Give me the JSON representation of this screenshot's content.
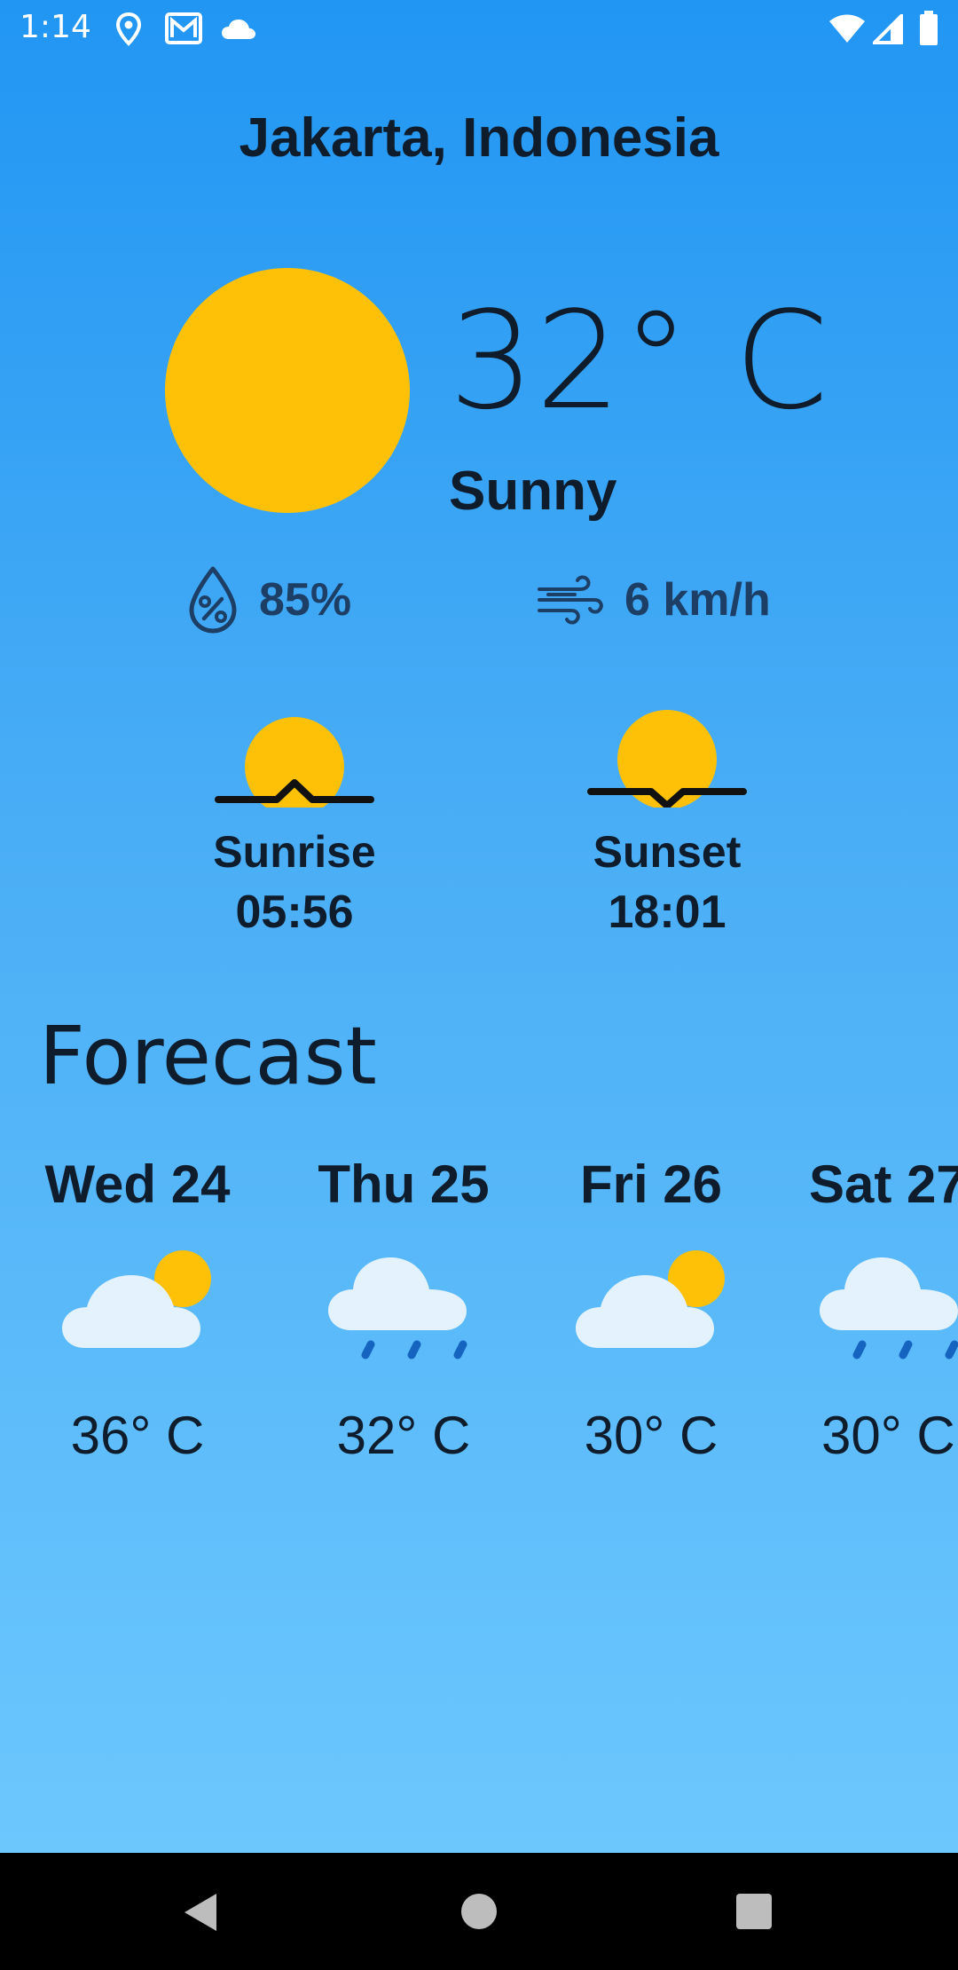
{
  "status_bar": {
    "time": "1:14",
    "icons": [
      "location-icon",
      "mail-icon",
      "cloud-icon",
      "wifi-icon",
      "signal-icon",
      "battery-icon"
    ]
  },
  "location": "Jakarta, Indonesia",
  "current": {
    "icon": "sun-icon",
    "temperature": "32° C",
    "condition": "Sunny",
    "humidity": "85%",
    "wind": "6 km/h"
  },
  "sun": {
    "sunrise_label": "Sunrise",
    "sunrise_time": "05:56",
    "sunset_label": "Sunset",
    "sunset_time": "18:01"
  },
  "forecast": {
    "title": "Forecast",
    "days": [
      {
        "day": "Wed 24",
        "icon": "partly-cloudy-icon",
        "temp": "36° C"
      },
      {
        "day": "Thu 25",
        "icon": "rain-cloud-icon",
        "temp": "32° C"
      },
      {
        "day": "Fri 26",
        "icon": "partly-cloudy-icon",
        "temp": "30° C"
      },
      {
        "day": "Sat 27",
        "icon": "rain-cloud-icon",
        "temp": "30° C"
      }
    ]
  },
  "colors": {
    "sun": "#ffc107",
    "cloud": "#e3f2fd",
    "rain": "#1565c0",
    "gradient_top": "#2196f3",
    "gradient_bottom": "#6cc7fd"
  }
}
